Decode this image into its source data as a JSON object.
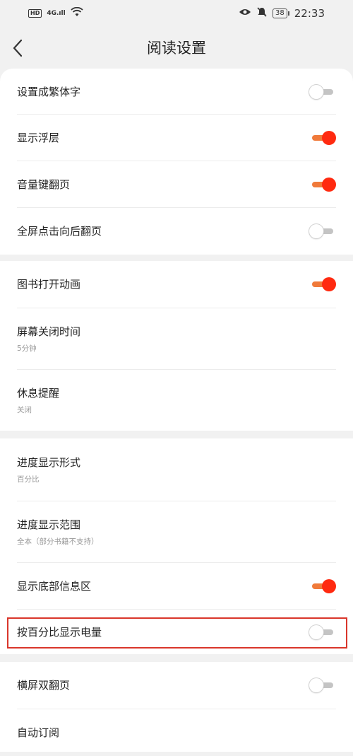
{
  "status_bar": {
    "hd": "HD",
    "network": "4G",
    "time": "22:33",
    "battery": "38",
    "icons": [
      "signal-icon",
      "wifi-icon",
      "eye-icon",
      "mute-icon",
      "battery-icon"
    ]
  },
  "header": {
    "title": "阅读设置",
    "back_icon": "chevron-left-icon"
  },
  "sections": [
    {
      "items": [
        {
          "label": "设置成繁体字",
          "toggle": "off"
        },
        {
          "label": "显示浮层",
          "toggle": "on"
        },
        {
          "label": "音量键翻页",
          "toggle": "on"
        },
        {
          "label": "全屏点击向后翻页",
          "toggle": "off"
        }
      ]
    },
    {
      "items": [
        {
          "label": "图书打开动画",
          "toggle": "on"
        },
        {
          "label": "屏幕关闭时间",
          "sub": "5分钟"
        },
        {
          "label": "休息提醒",
          "sub": "关闭"
        }
      ]
    },
    {
      "items": [
        {
          "label": "进度显示形式",
          "sub": "百分比"
        },
        {
          "label": "进度显示范围",
          "sub": "全本（部分书籍不支持）"
        },
        {
          "label": "显示底部信息区",
          "toggle": "on"
        },
        {
          "label": "按百分比显示电量",
          "toggle": "off",
          "highlighted": true
        }
      ]
    },
    {
      "items": [
        {
          "label": "横屏双翻页",
          "toggle": "off"
        },
        {
          "label": "自动订阅"
        }
      ]
    }
  ],
  "colors": {
    "accent": "#ff2a10",
    "track_on": "#f07a3a",
    "highlight": "#d9362b",
    "background": "#f1f1f1"
  }
}
